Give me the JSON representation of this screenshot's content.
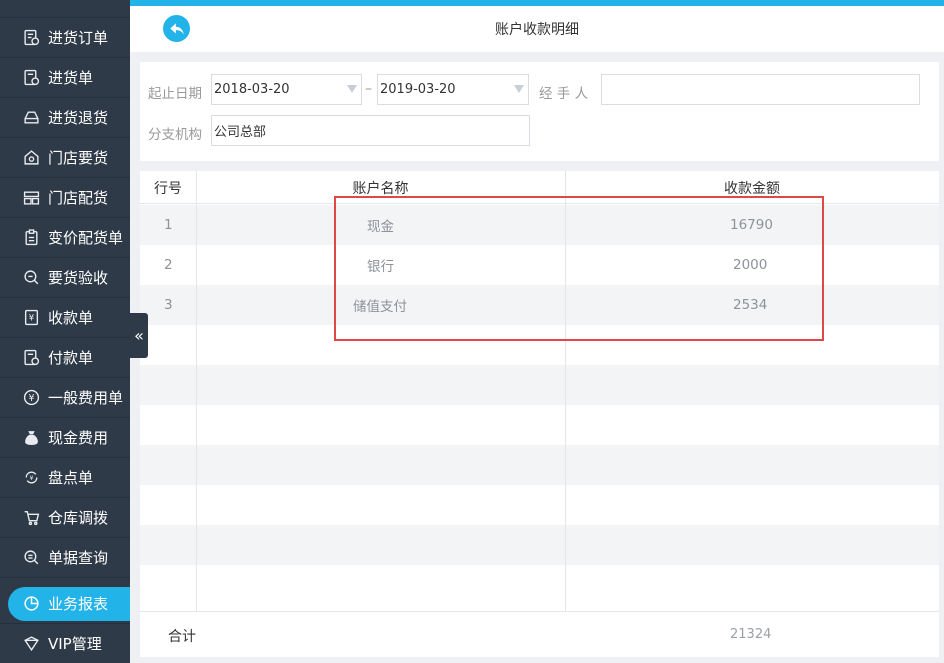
{
  "sidebar": {
    "items": [
      {
        "label": "进货订单",
        "icon": "purchase-order-icon"
      },
      {
        "label": "进货单",
        "icon": "purchase-receipt-icon"
      },
      {
        "label": "进货退货",
        "icon": "purchase-return-icon"
      },
      {
        "label": "门店要货",
        "icon": "store-request-icon"
      },
      {
        "label": "门店配货",
        "icon": "store-distribution-icon"
      },
      {
        "label": "变价配货单",
        "icon": "price-change-icon"
      },
      {
        "label": "要货验收",
        "icon": "acceptance-icon"
      },
      {
        "label": "收款单",
        "icon": "receipt-icon"
      },
      {
        "label": "付款单",
        "icon": "payment-icon"
      },
      {
        "label": "一般费用单",
        "icon": "yuan-icon"
      },
      {
        "label": "现金费用",
        "icon": "money-bag-icon"
      },
      {
        "label": "盘点单",
        "icon": "inventory-icon"
      },
      {
        "label": "仓库调拨",
        "icon": "cart-icon"
      },
      {
        "label": "单据查询",
        "icon": "search-doc-icon"
      },
      {
        "label": "业务报表",
        "icon": "pie-chart-icon",
        "active": true
      },
      {
        "label": "VIP管理",
        "icon": "vip-icon"
      }
    ],
    "collapse_glyph": "«"
  },
  "header": {
    "title": "账户收款明细"
  },
  "filter": {
    "date_label": "起止日期",
    "date_from": "2018-03-20",
    "date_sep": "–",
    "date_to": "2019-03-20",
    "handler_label": "经 手 人",
    "handler_value": "",
    "branch_label": "分支机构",
    "branch_value": "公司总部"
  },
  "table": {
    "headers": [
      "行号",
      "账户名称",
      "收款金额"
    ],
    "rows": [
      {
        "no": "1",
        "name": "现金",
        "amount": "16790"
      },
      {
        "no": "2",
        "name": "银行",
        "amount": "2000"
      },
      {
        "no": "3",
        "name": "储值支付",
        "amount": "2534"
      }
    ],
    "total_label": "合计",
    "total_value": "21324"
  },
  "colors": {
    "accent": "#22b3e8",
    "sidebar_bg": "#2f3a48",
    "highlight": "#e04848"
  }
}
